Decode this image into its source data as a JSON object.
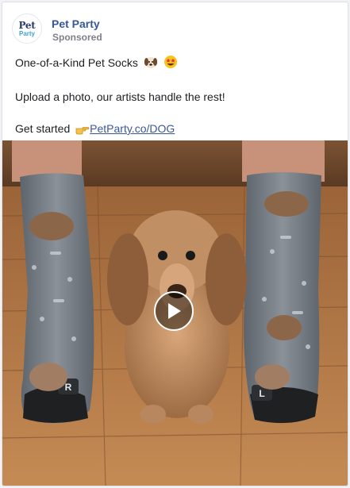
{
  "post": {
    "page_name": "Pet Party",
    "sponsored_label": "Sponsored",
    "avatar": {
      "line1": "Pet",
      "line2": "Party"
    },
    "text": {
      "line1": "One-of-a-Kind Pet Socks",
      "line1_emojis": [
        "dog-face-emoji",
        "star-struck-emoji"
      ],
      "line2": "Upload a photo, our artists handle the rest!",
      "line3_prefix": "Get started",
      "line3_emoji": "pointing-hand-emoji",
      "link": "PetParty.co/DOG"
    },
    "media": {
      "type": "video",
      "description_icons": [
        "play-icon"
      ],
      "sock_labels": [
        "R",
        "L"
      ]
    }
  },
  "colors": {
    "page_name": "#365899",
    "link": "#385898",
    "sponsored": "#7d8188",
    "floor": "#b57a45",
    "sock": "#7a8088"
  }
}
